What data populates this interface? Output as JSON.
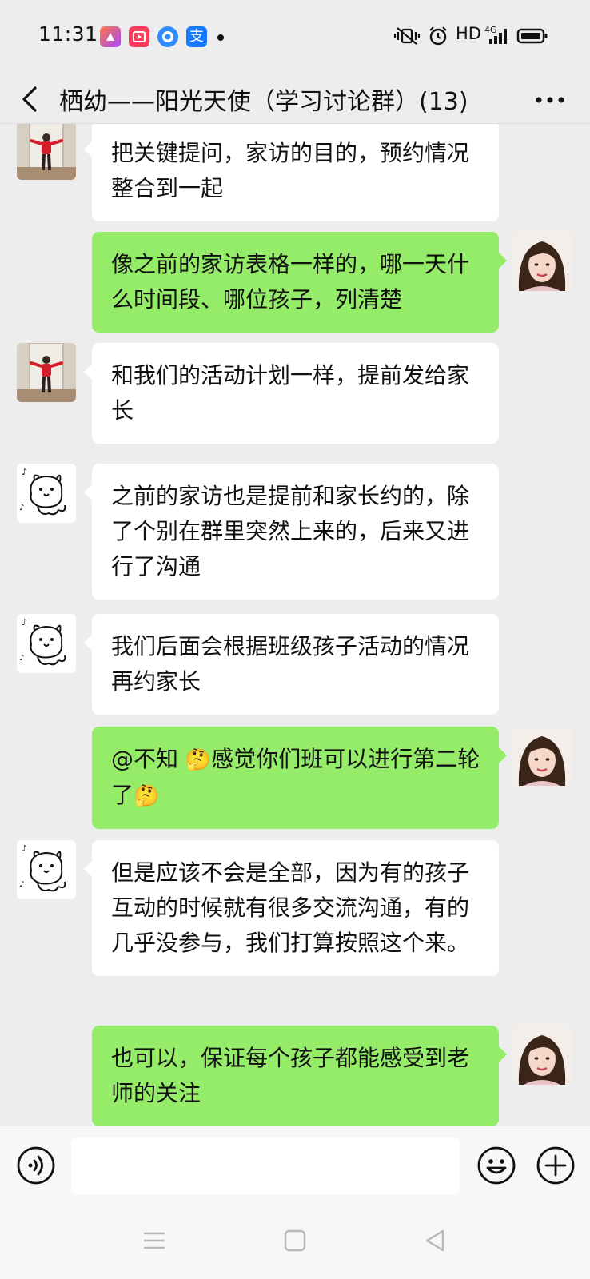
{
  "status_bar": {
    "time": "11:31",
    "hd_label": "HD",
    "network_label": "4G",
    "app_icons": [
      "kuaishou-icon",
      "video-app-icon",
      "browser-app-icon",
      "alipay-icon"
    ],
    "alipay_glyph": "支"
  },
  "header": {
    "title": "栖幼——阳光天使（学习讨论群）(13)"
  },
  "colors": {
    "outgoing_bubble": "#95ec69",
    "incoming_bubble": "#ffffff",
    "background": "#ededed"
  },
  "messages": [
    {
      "side": "left",
      "avatar": "child-photo",
      "text": "把关键提问，家访的目的，预约情况整合到一起"
    },
    {
      "side": "right",
      "avatar": "woman-photo",
      "text": "像之前的家访表格一样的，哪一天什么时间段、哪位孩子，列清楚"
    },
    {
      "side": "left",
      "avatar": "child-photo",
      "text": "和我们的活动计划一样，提前发给家长"
    },
    {
      "side": "left",
      "avatar": "cartoon-dog",
      "text": "之前的家访也是提前和家长约的，除了个别在群里突然上来的，后来又进行了沟通"
    },
    {
      "side": "left",
      "avatar": "cartoon-dog",
      "text": "我们后面会根据班级孩子活动的情况再约家长"
    },
    {
      "side": "right",
      "avatar": "woman-photo",
      "text_parts": [
        "@不知 ",
        "🤔",
        "感觉你们班可以进行第二轮了",
        "🤔"
      ]
    },
    {
      "side": "left",
      "avatar": "cartoon-dog",
      "text": "但是应该不会是全部，因为有的孩子互动的时候就有很多交流沟通，有的几乎没参与，我们打算按照这个来。"
    },
    {
      "side": "right",
      "avatar": "woman-photo",
      "text": "也可以，保证每个孩子都能感受到老师的关注"
    }
  ],
  "input_bar": {
    "text_value": "",
    "voice_icon": "voice-icon",
    "emoji_icon": "emoji-icon",
    "plus_icon": "plus-icon"
  },
  "nav_bar": {
    "icons": [
      "menu-icon",
      "home-icon",
      "back-icon"
    ]
  }
}
